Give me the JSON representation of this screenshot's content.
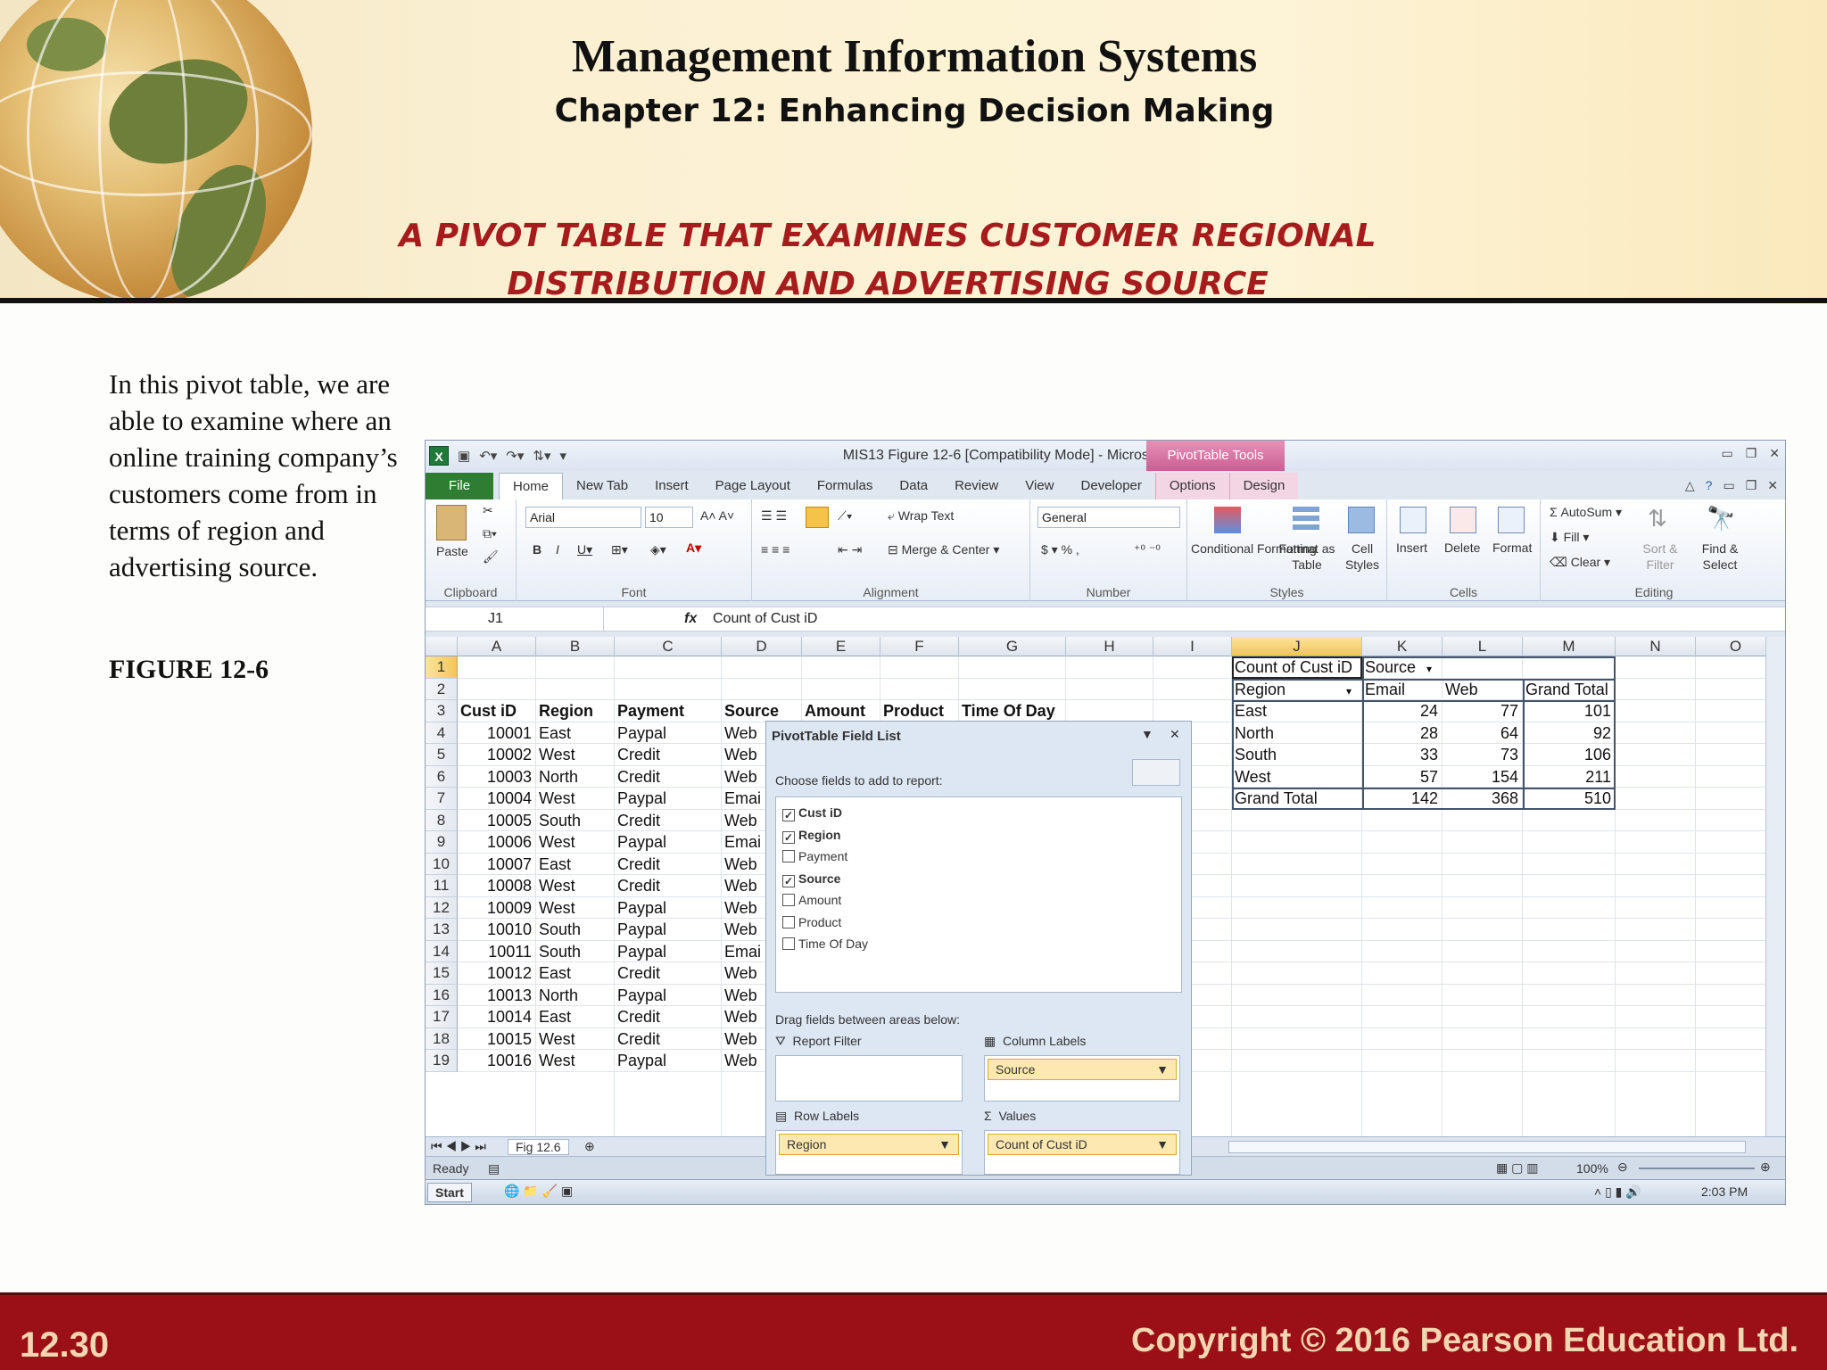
{
  "slide": {
    "title": "Management Information Systems",
    "subtitle": "Chapter 12: Enhancing Decision Making",
    "figure_title_line1": "A PIVOT TABLE THAT EXAMINES CUSTOMER REGIONAL",
    "figure_title_line2": "DISTRIBUTION AND ADVERTISING SOURCE",
    "description": "In this pivot table, we are able to examine where an online training company’s customers come from in terms of region and advertising source.",
    "figure_label": "FIGURE 12-6",
    "slide_number": "12.30",
    "copyright": "Copyright © 2016 Pearson Education Ltd."
  },
  "excel": {
    "window_title": "MIS13 Figure 12-6  [Compatibility Mode]  -  Microsoft Excel",
    "context_tab_group": "PivotTable Tools",
    "tabs": [
      "File",
      "Home",
      "New Tab",
      "Insert",
      "Page Layout",
      "Formulas",
      "Data",
      "Review",
      "View",
      "Developer",
      "Options",
      "Design"
    ],
    "ribbon": {
      "paste": "Paste",
      "clipboard": "Clipboard",
      "font_name": "Arial",
      "font_size": "10",
      "font_group": "Font",
      "wrap_text": "Wrap Text",
      "merge_center": "Merge & Center",
      "alignment": "Alignment",
      "number_format": "General",
      "number": "Number",
      "conditional_formatting": "Conditional Formatting",
      "format_as_table": "Format as Table",
      "cell_styles": "Cell Styles",
      "styles": "Styles",
      "insert": "Insert",
      "delete": "Delete",
      "format": "Format",
      "cells": "Cells",
      "autosum": "AutoSum",
      "fill": "Fill",
      "clear": "Clear",
      "sort_filter": "Sort & Filter",
      "find_select": "Find & Select",
      "editing": "Editing"
    },
    "name_box": "J1",
    "formula_value": "Count of Cust iD",
    "columns": [
      "A",
      "B",
      "C",
      "D",
      "E",
      "F",
      "G",
      "H",
      "I",
      "J",
      "K",
      "L",
      "M",
      "N",
      "O"
    ],
    "rows": [
      "1",
      "2",
      "3",
      "4",
      "5",
      "6",
      "7",
      "8",
      "9",
      "10",
      "11",
      "12",
      "13",
      "14",
      "15",
      "16",
      "17",
      "18",
      "19"
    ],
    "data_headers": [
      "Cust iD",
      "Region",
      "Payment",
      "Source",
      "Amount",
      "Product",
      "Time Of Day"
    ],
    "data_rows": [
      [
        "10001",
        "East",
        "Paypal",
        "Web"
      ],
      [
        "10002",
        "West",
        "Credit",
        "Web"
      ],
      [
        "10003",
        "North",
        "Credit",
        "Web"
      ],
      [
        "10004",
        "West",
        "Paypal",
        "Emai"
      ],
      [
        "10005",
        "South",
        "Credit",
        "Web"
      ],
      [
        "10006",
        "West",
        "Paypal",
        "Emai"
      ],
      [
        "10007",
        "East",
        "Credit",
        "Web"
      ],
      [
        "10008",
        "West",
        "Credit",
        "Web"
      ],
      [
        "10009",
        "West",
        "Paypal",
        "Web"
      ],
      [
        "10010",
        "South",
        "Paypal",
        "Web"
      ],
      [
        "10011",
        "South",
        "Paypal",
        "Emai"
      ],
      [
        "10012",
        "East",
        "Credit",
        "Web"
      ],
      [
        "10013",
        "North",
        "Paypal",
        "Web"
      ],
      [
        "10014",
        "East",
        "Credit",
        "Web"
      ],
      [
        "10015",
        "West",
        "Credit",
        "Web"
      ],
      [
        "10016",
        "West",
        "Paypal",
        "Web"
      ]
    ],
    "pivot": {
      "value_label": "Count of Cust iD",
      "column_field": "Source",
      "row_field": "Region",
      "col_headers": [
        "Email",
        "Web",
        "Grand Total"
      ],
      "rows": [
        {
          "label": "East",
          "values": [
            "24",
            "77",
            "101"
          ]
        },
        {
          "label": "North",
          "values": [
            "28",
            "64",
            "92"
          ]
        },
        {
          "label": "South",
          "values": [
            "33",
            "73",
            "106"
          ]
        },
        {
          "label": "West",
          "values": [
            "57",
            "154",
            "211"
          ]
        },
        {
          "label": "Grand Total",
          "values": [
            "142",
            "368",
            "510"
          ]
        }
      ]
    },
    "field_list": {
      "title": "PivotTable Field List",
      "choose_label": "Choose fields to add to report:",
      "fields": [
        {
          "name": "Cust iD",
          "checked": true
        },
        {
          "name": "Region",
          "checked": true
        },
        {
          "name": "Payment",
          "checked": false
        },
        {
          "name": "Source",
          "checked": true
        },
        {
          "name": "Amount",
          "checked": false
        },
        {
          "name": "Product",
          "checked": false
        },
        {
          "name": "Time Of Day",
          "checked": false
        }
      ],
      "drag_label": "Drag fields between areas below:",
      "report_filter": "Report Filter",
      "column_labels": "Column Labels",
      "column_value": "Source",
      "row_labels": "Row Labels",
      "row_value": "Region",
      "values": "Values",
      "values_value": "Count of Cust iD"
    },
    "sheet_tab": "Fig 12.6",
    "status": "Ready",
    "zoom": "100%",
    "start": "Start",
    "clock": "2:03 PM"
  }
}
